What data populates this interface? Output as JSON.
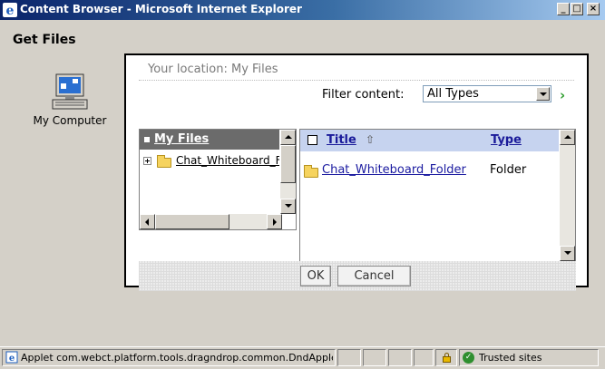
{
  "window": {
    "title": "Content Browser - Microsoft Internet Explorer",
    "controls": {
      "minimize": "_",
      "maximize": "□",
      "close": "×"
    }
  },
  "page": {
    "heading": "Get Files",
    "desktop_icon": {
      "label": "My Computer",
      "icon": "computer-icon"
    }
  },
  "dialog": {
    "location": "Your location: My Files",
    "filter": {
      "label": "Filter content:",
      "value": "All Types",
      "go_icon": "›"
    },
    "tree": {
      "root": "My Files",
      "items": [
        {
          "label": "Chat_Whiteboard_Folder",
          "icon": "folder-icon"
        }
      ]
    },
    "list": {
      "columns": {
        "title": "Title",
        "type": "Type",
        "sort_icon": "⇧"
      },
      "rows": [
        {
          "name": "Chat_Whiteboard_Folder",
          "type": "Folder",
          "icon": "folder-icon"
        }
      ]
    },
    "buttons": {
      "ok": "OK",
      "cancel": "Cancel"
    }
  },
  "statusbar": {
    "message": "Applet com.webct.platform.tools.dragndrop.common.DndApplet started",
    "zone": "Trusted sites"
  },
  "colors": {
    "titlebar": "#0a246a",
    "link": "#1a1aa0",
    "list_header": "#c6d3ef",
    "tree_header": "#6b6b6b"
  }
}
